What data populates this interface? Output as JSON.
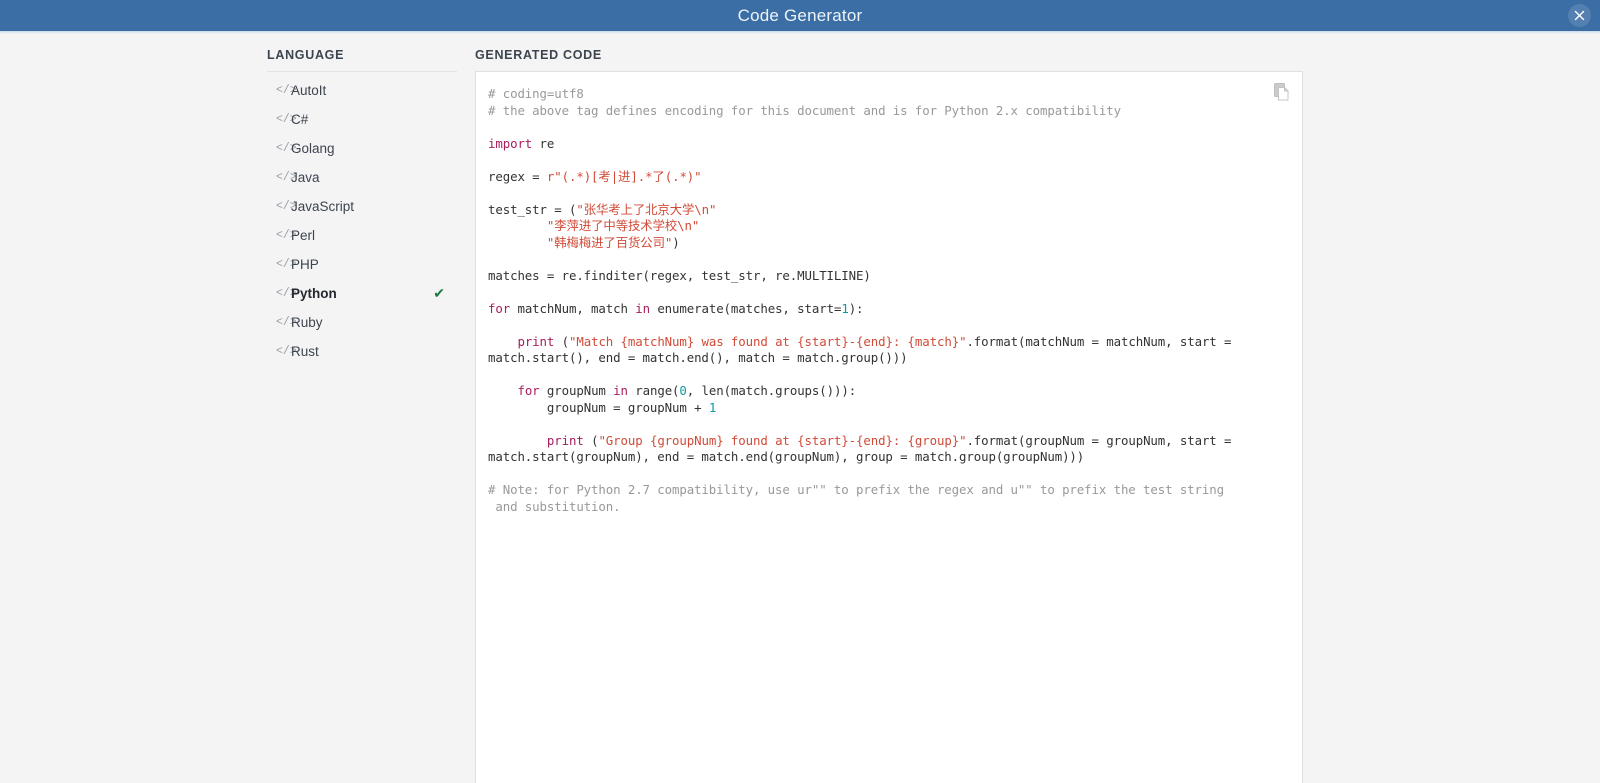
{
  "window": {
    "title": "Code Generator",
    "close_label": "×",
    "titlebar_color": "#3a6ea5"
  },
  "sidebar": {
    "heading": "LANGUAGE",
    "icon_glyph": "</>",
    "check_glyph": "✔",
    "items": [
      {
        "label": "AutoIt",
        "selected": false
      },
      {
        "label": "C#",
        "selected": false
      },
      {
        "label": "Golang",
        "selected": false
      },
      {
        "label": "Java",
        "selected": false
      },
      {
        "label": "JavaScript",
        "selected": false
      },
      {
        "label": "Perl",
        "selected": false
      },
      {
        "label": "PHP",
        "selected": false
      },
      {
        "label": "Python",
        "selected": true
      },
      {
        "label": "Ruby",
        "selected": false
      },
      {
        "label": "Rust",
        "selected": false
      }
    ]
  },
  "code_panel": {
    "heading": "GENERATED CODE",
    "copy_icon": "copy-icon",
    "language": "Python",
    "tokens": [
      {
        "t": "comment",
        "s": "# coding=utf8\n# the above tag defines encoding for this document and is for Python 2.x compatibility\n"
      },
      {
        "t": "plain",
        "s": "\n"
      },
      {
        "t": "kw",
        "s": "import"
      },
      {
        "t": "plain",
        "s": " re\n\nregex = "
      },
      {
        "t": "str",
        "s": "r\"(.*)[考|进].*了(.*)\""
      },
      {
        "t": "plain",
        "s": "\n\ntest_str = ("
      },
      {
        "t": "str",
        "s": "\"张华考上了北京大学\\n\"\n        \"李萍进了中等技术学校\\n\"\n        \"韩梅梅进了百货公司\""
      },
      {
        "t": "plain",
        "s": ")\n\nmatches = re.finditer(regex, test_str, re.MULTILINE)\n\n"
      },
      {
        "t": "kw",
        "s": "for"
      },
      {
        "t": "plain",
        "s": " matchNum, match "
      },
      {
        "t": "kw",
        "s": "in"
      },
      {
        "t": "plain",
        "s": " enumerate(matches, start="
      },
      {
        "t": "num",
        "s": "1"
      },
      {
        "t": "plain",
        "s": "):\n\n    "
      },
      {
        "t": "kw",
        "s": "print"
      },
      {
        "t": "plain",
        "s": " ("
      },
      {
        "t": "str",
        "s": "\"Match {matchNum} was found at {start}-{end}: {match}\""
      },
      {
        "t": "plain",
        "s": ".format(matchNum = matchNum, start = match.start(), end = match.end(), match = match.group()))\n\n    "
      },
      {
        "t": "kw",
        "s": "for"
      },
      {
        "t": "plain",
        "s": " groupNum "
      },
      {
        "t": "kw",
        "s": "in"
      },
      {
        "t": "plain",
        "s": " range("
      },
      {
        "t": "num",
        "s": "0"
      },
      {
        "t": "plain",
        "s": ", len(match.groups())):\n        groupNum = groupNum + "
      },
      {
        "t": "num",
        "s": "1"
      },
      {
        "t": "plain",
        "s": "\n\n        "
      },
      {
        "t": "kw",
        "s": "print"
      },
      {
        "t": "plain",
        "s": " ("
      },
      {
        "t": "str",
        "s": "\"Group {groupNum} found at {start}-{end}: {group}\""
      },
      {
        "t": "plain",
        "s": ".format(groupNum = groupNum, start = match.start(groupNum), end = match.end(groupNum), group = match.group(groupNum)))\n\n"
      },
      {
        "t": "comment",
        "s": "# Note: for Python 2.7 compatibility, use ur\"\" to prefix the regex and u\"\" to prefix the test string\n and substitution."
      }
    ]
  }
}
